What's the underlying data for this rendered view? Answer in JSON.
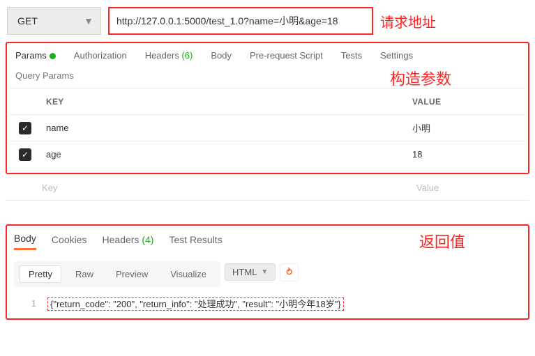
{
  "topbar": {
    "method": "GET",
    "url": "http://127.0.0.1:5000/test_1.0?name=小明&age=18",
    "annotation": "请求地址"
  },
  "req_tabs": {
    "params": "Params",
    "authorization": "Authorization",
    "headers": "Headers",
    "headers_count": "(6)",
    "body": "Body",
    "prerequest": "Pre-request Script",
    "tests": "Tests",
    "settings": "Settings"
  },
  "query": {
    "title": "Query Params",
    "annotation": "构造参数",
    "col_key": "KEY",
    "col_value": "VALUE",
    "rows": [
      {
        "key": "name",
        "value": "小明"
      },
      {
        "key": "age",
        "value": "18"
      }
    ],
    "placeholder_key": "Key",
    "placeholder_value": "Value"
  },
  "resp": {
    "annotation": "返回值",
    "tabs": {
      "body": "Body",
      "cookies": "Cookies",
      "headers": "Headers",
      "headers_count": "(4)",
      "test_results": "Test Results"
    },
    "toolbar": {
      "pretty": "Pretty",
      "raw": "Raw",
      "preview": "Preview",
      "visualize": "Visualize",
      "format": "HTML"
    },
    "line_num": "1",
    "body_text": "{\"return_code\": \"200\", \"return_info\": \"处理成功\", \"result\": \"小明今年18岁\"}"
  }
}
